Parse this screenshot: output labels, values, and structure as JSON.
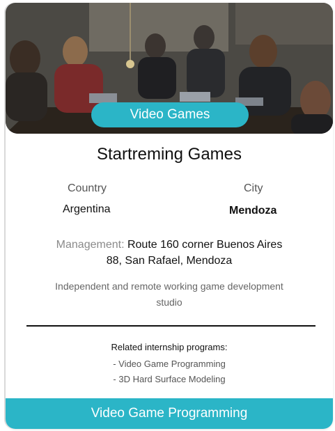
{
  "card": {
    "category": "Video Games",
    "company_name": "Startreming Games",
    "country_label": "Country",
    "country_value": "Argentina",
    "city_label": "City",
    "city_value": "Mendoza",
    "management_label": "Management:",
    "management_value": "Route 160 corner Buenos Aires 88, San Rafael, Mendoza",
    "description": "Independent and remote working game development studio",
    "programs_title": "Related internship programs:",
    "programs": [
      "- Video Game Programming",
      "- 3D Hard Surface Modeling"
    ],
    "cta_label": "Video Game Programming"
  },
  "colors": {
    "accent": "#2bb5c7",
    "text": "#111111",
    "muted": "#555555"
  },
  "icons": {
    "hero": "team-photo"
  }
}
